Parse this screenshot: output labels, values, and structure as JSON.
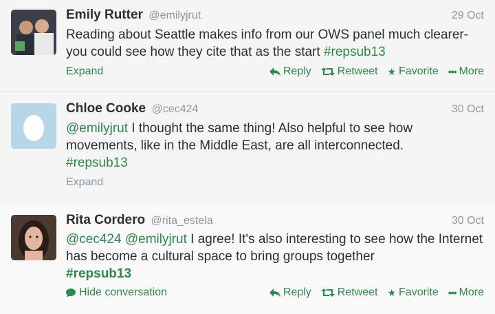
{
  "colors": {
    "accent": "#2a8a4a",
    "muted": "#8899a6",
    "text": "#292f33"
  },
  "tweets": [
    {
      "name": "Emily Rutter",
      "handle": "@emilyjrut",
      "date": "29 Oct",
      "text": "Reading about Seattle makes info from our OWS panel much clearer- you could see how they cite that as the start ",
      "hashtag": "#repsub13",
      "expand": "Expand",
      "actions": {
        "reply": "Reply",
        "retweet": "Retweet",
        "favorite": "Favorite",
        "more": "More"
      }
    },
    {
      "name": "Chloe Cooke",
      "handle": "@cec424",
      "date": "30 Oct",
      "mention": "@emilyjrut",
      "text": " I thought the same thing! Also helpful to see how movements, like in the Middle East, are all interconnected.",
      "hashtag": "#repsub13",
      "expand": "Expand"
    },
    {
      "name": "Rita Cordero",
      "handle": "@rita_estela",
      "date": "30 Oct",
      "mention1": "@cec424",
      "mention2": "@emilyjrut",
      "text": " I agree! It's also interesting to see how the Internet has become a cultural space to bring groups together",
      "hashtag": "#repsub13",
      "hide": "Hide conversation",
      "actions": {
        "reply": "Reply",
        "retweet": "Retweet",
        "favorite": "Favorite",
        "more": "More"
      }
    }
  ]
}
